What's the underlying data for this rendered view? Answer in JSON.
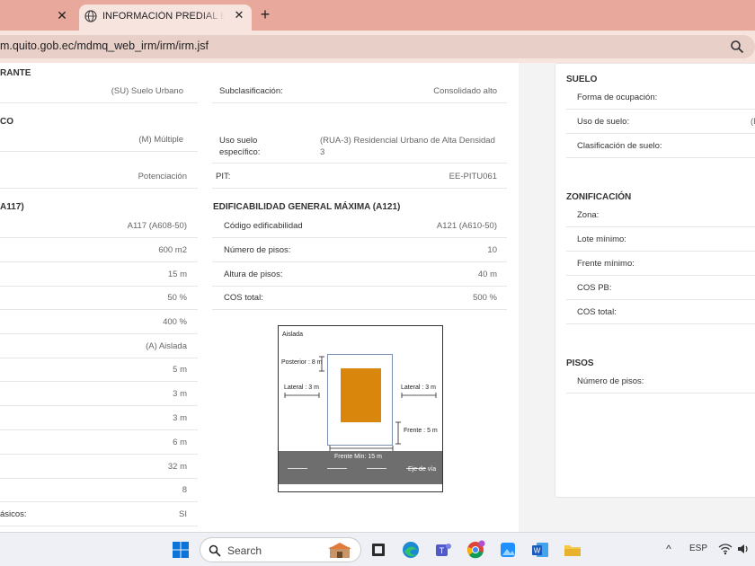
{
  "browser": {
    "tab_title": "INFORMACIÓN PREDIAL EN UN",
    "tab_close_glyph": "✕",
    "new_tab_glyph": "+",
    "url": "m.quito.gob.ec/mdmq_web_irm/irm/irm.jsf"
  },
  "left": {
    "section1_title": "RANTE",
    "row1": {
      "value": "(SU) Suelo Urbano"
    },
    "subclasificacion": {
      "label": "Subclasificación:",
      "value": "Consolidado alto"
    },
    "section2_title": "CO",
    "row2": {
      "value": "(M) Múltiple"
    },
    "uso_especifico": {
      "label": "Uso suelo específico:",
      "value": "(RUA-3) Residencial Urbano de Alta Densidad 3"
    },
    "row3": {
      "value": "Potenciación"
    },
    "pit": {
      "label": "PIT:",
      "value": "EE-PITU061"
    },
    "section3_title": "A117)",
    "col1_values": [
      "A117 (A608-50)",
      "600 m2",
      "15 m",
      "50 %",
      "400 %",
      "(A) Aislada",
      "5 m",
      "3 m",
      "3 m",
      "6 m",
      "32 m",
      "8"
    ],
    "last_row": {
      "label": "ásicos:",
      "value": "SI"
    },
    "edif_title": "EDIFICABILIDAD GENERAL MÁXIMA (A121)",
    "edif_rows": [
      {
        "label": "Código edificabilidad",
        "value": "A121 (A610-50)"
      },
      {
        "label": "Número de pisos:",
        "value": "10"
      },
      {
        "label": "Altura de pisos:",
        "value": "40 m"
      },
      {
        "label": "COS total:",
        "value": "500 %"
      }
    ]
  },
  "diagram": {
    "title": "Aislada",
    "posterior": "Posterior : 8 m",
    "lateral_left": "Lateral : 3 m",
    "lateral_right": "Lateral : 3 m",
    "frente": "Frente : 5 m",
    "frente_min": "Frente Min: 15 m",
    "eje_via": "Eje de vía",
    "building_color": "#d9860c"
  },
  "right": {
    "suelo_title": "SUELO",
    "suelo_rows": [
      "Forma de ocupación:",
      "Uso de suelo:",
      "Clasificación de suelo:"
    ],
    "uso_suelo_value": "(F",
    "zonif_title": "ZONIFICACIÓN",
    "zonif_rows": [
      "Zona:",
      "Lote mínimo:",
      "Frente mínimo:",
      "COS PB:",
      "COS total:"
    ],
    "pisos_title": "PISOS",
    "pisos_rows": [
      "Número de pisos:"
    ]
  },
  "taskbar": {
    "search_label": "Search",
    "lang": "ESP",
    "chevron": "^"
  }
}
